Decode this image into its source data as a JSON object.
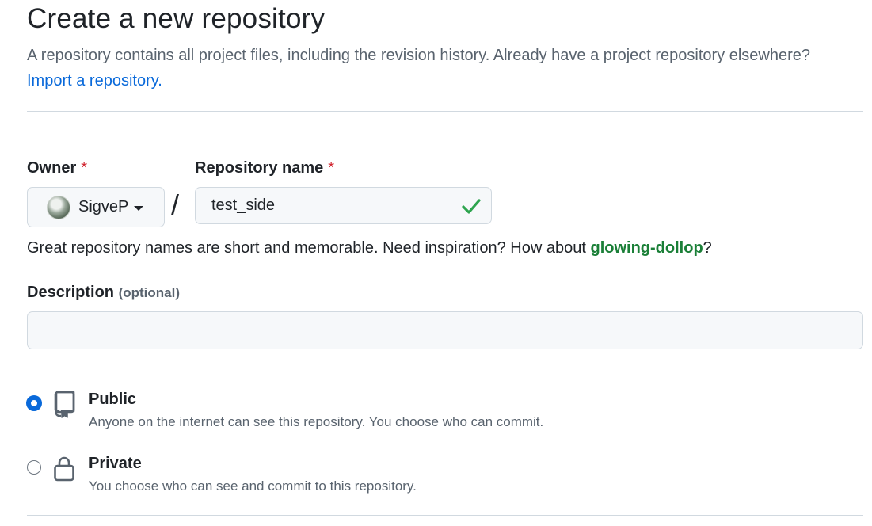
{
  "header": {
    "title": "Create a new repository",
    "subtitle": "A repository contains all project files, including the revision history. Already have a project repository elsewhere?",
    "import_link": "Import a repository."
  },
  "owner": {
    "label": "Owner",
    "required_mark": "*",
    "value": "SigveP"
  },
  "separator": "/",
  "repo_name": {
    "label": "Repository name",
    "required_mark": "*",
    "value": "test_side",
    "valid": true
  },
  "name_hint": {
    "prefix": "Great repository names are short and memorable. Need inspiration? How about ",
    "suggestion": "glowing-dollop",
    "suffix": "?"
  },
  "description": {
    "label": "Description",
    "optional": "(optional)",
    "value": ""
  },
  "visibility": {
    "selected": "public",
    "options": [
      {
        "id": "public",
        "title": "Public",
        "desc": "Anyone on the internet can see this repository. You choose who can commit.",
        "icon": "repo-icon"
      },
      {
        "id": "private",
        "title": "Private",
        "desc": "You choose who can see and commit to this repository.",
        "icon": "lock-icon"
      }
    ]
  },
  "colors": {
    "link": "#0969da",
    "success": "#1a7f37",
    "danger": "#d1242f",
    "accent": "#0969da"
  }
}
